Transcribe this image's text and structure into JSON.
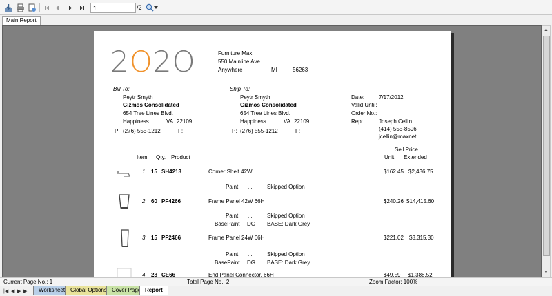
{
  "toolbar": {
    "page_number": "1",
    "page_total": "/2"
  },
  "doc_tab": "Main Report",
  "report": {
    "vendor": {
      "name": "Furniture Max",
      "street": "550 Mainline Ave",
      "city": "Anywhere",
      "state": "MI",
      "zip": "56263"
    },
    "bill_to": {
      "label": "Bill To:",
      "contact": "Peytr Smyth",
      "company": "Gizmos Consolidated",
      "street": "654 Tree Lines Blvd.",
      "city": "Happiness",
      "state": "VA",
      "zip": "22109",
      "phone_label": "P:",
      "phone": "(276) 555-1212",
      "fax_label": "F:"
    },
    "ship_to": {
      "label": "Ship To:",
      "contact": "Peytr Smyth",
      "company": "Gizmos Consolidated",
      "street": "654 Tree Lines Blvd.",
      "city": "Happiness",
      "state": "VA",
      "zip": "22109",
      "phone_label": "P:",
      "phone": "(276) 555-1212",
      "fax_label": "F:"
    },
    "meta": {
      "date_label": "Date:",
      "date": "7/17/2012",
      "valid_label": "Valid Until:",
      "order_label": "Order No.:",
      "rep_label": "Rep:",
      "rep_name": "Joseph Cellin",
      "rep_phone": "(414) 555-8596",
      "rep_email": "jcellin@maxnet"
    },
    "columns": {
      "item": "Item",
      "qty": "Qty.",
      "product": "Product",
      "sell_price": "Sell Price",
      "unit": "Unit",
      "extended": "Extended"
    },
    "lines": [
      {
        "item": "1",
        "qty": "15",
        "code": "SH4213",
        "desc": "Corner Shelf 42W",
        "unit": "$162.45",
        "extended": "$2,436.75",
        "options": [
          {
            "name": "Paint",
            "code": "...",
            "desc": "Skipped Option"
          }
        ]
      },
      {
        "item": "2",
        "qty": "60",
        "code": "PF4266",
        "desc": "Frame Panel 42W 66H",
        "unit": "$240.26",
        "extended": "$14,415.60",
        "options": [
          {
            "name": "Paint",
            "code": "...",
            "desc": "Skipped Option"
          },
          {
            "name": "BasePaint",
            "code": "DG",
            "desc": "BASE: Dark Grey"
          }
        ]
      },
      {
        "item": "3",
        "qty": "15",
        "code": "PF2466",
        "desc": "Frame Panel 24W 66H",
        "unit": "$221.02",
        "extended": "$3,315.30",
        "options": [
          {
            "name": "Paint",
            "code": "...",
            "desc": "Skipped Option"
          },
          {
            "name": "BasePaint",
            "code": "DG",
            "desc": "BASE: Dark Grey"
          }
        ]
      },
      {
        "item": "4",
        "qty": "28",
        "code": "CE66",
        "desc": "End Panel Connector, 66H",
        "unit": "$49.59",
        "extended": "$1,388.52",
        "options": []
      }
    ]
  },
  "status": {
    "current_page": "Current Page No.: 1",
    "total_pages": "Total Page No.: 2",
    "zoom": "Zoom Factor: 100%"
  },
  "sheet_tabs": [
    {
      "label": "Worksheet",
      "color": "#b8cfe8"
    },
    {
      "label": "Global Options",
      "color": "#e9e39b"
    },
    {
      "label": "Cover Page",
      "color": "#c9e3a6"
    },
    {
      "label": "Report",
      "color": "#ffffff"
    }
  ],
  "colors": {
    "logo_accent": "#f0922b",
    "logo_gray": "#7a7a7a"
  }
}
